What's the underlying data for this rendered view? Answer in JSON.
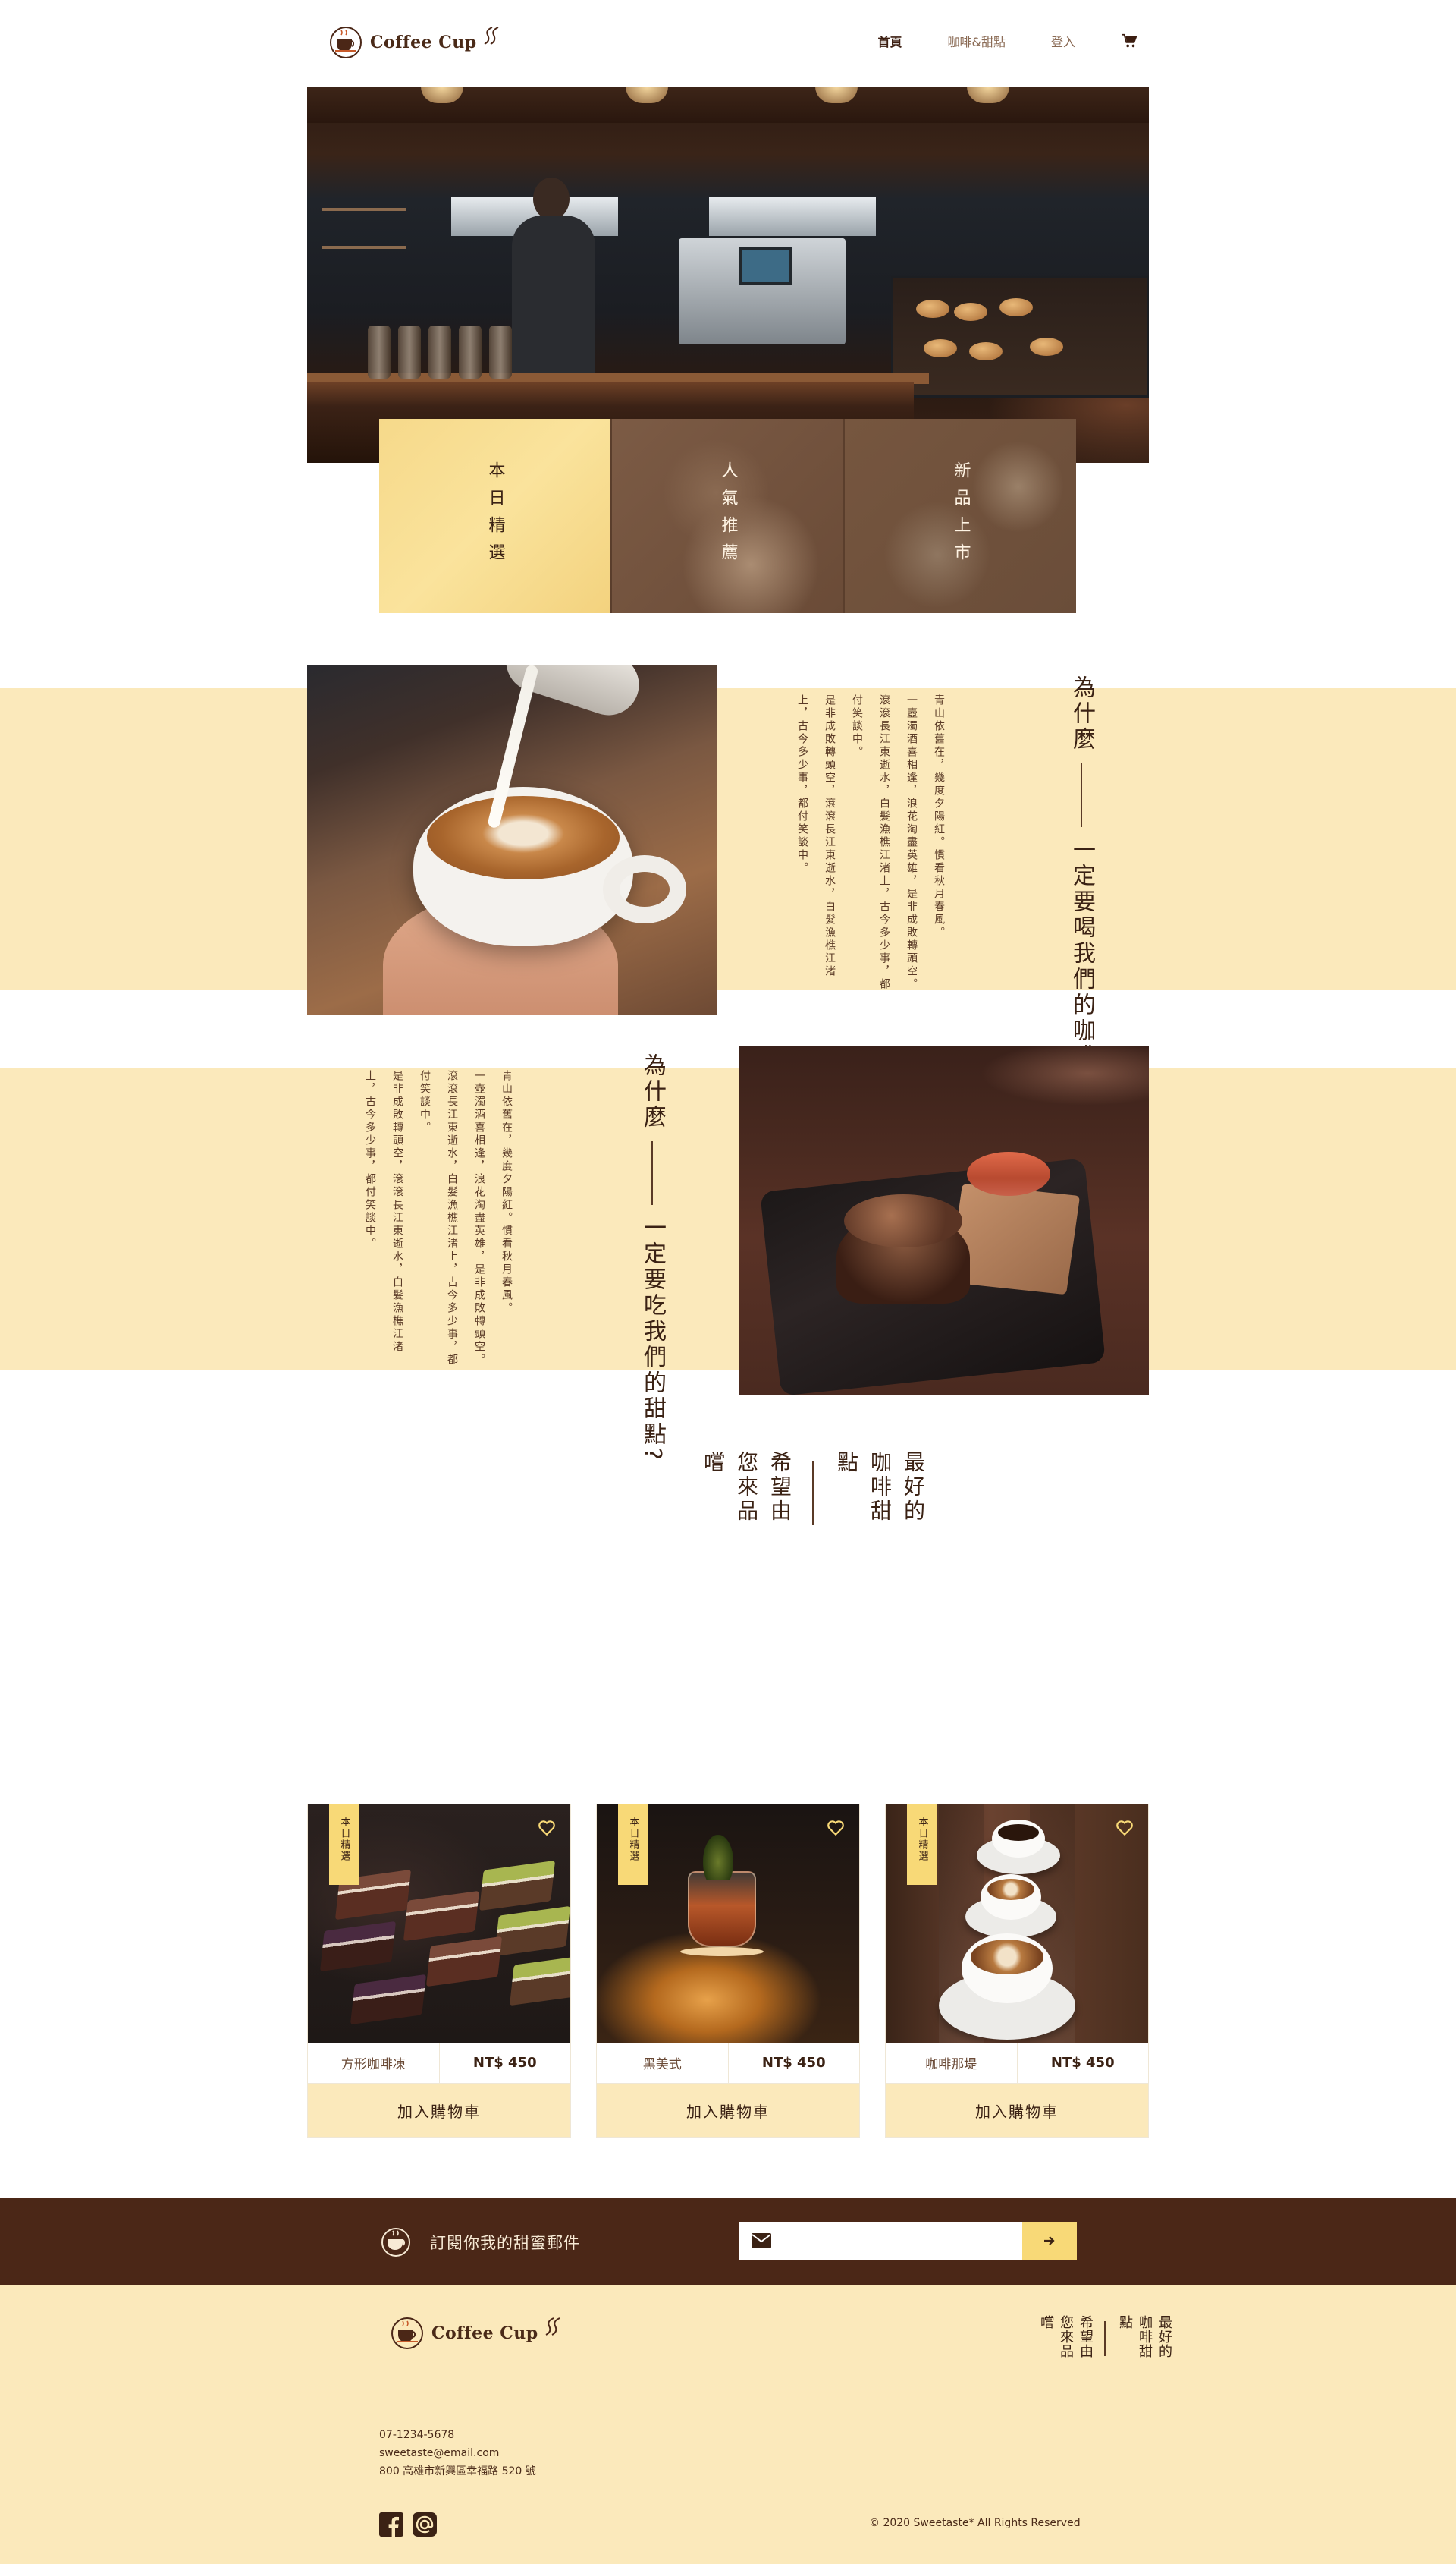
{
  "brand": {
    "name": "Coffee Cup",
    "brown": "#4b2717",
    "cream": "#fbe9bb",
    "yellow": "#f8d977"
  },
  "nav": {
    "items": [
      "首頁",
      "咖啡&甜點",
      "登入"
    ],
    "active_index": 0,
    "cart_icon": "cart-icon"
  },
  "hero": {
    "tiles": [
      "本日精選",
      "人氣推薦",
      "新品上市"
    ]
  },
  "coffee_feature": {
    "title_a": "為什麼",
    "title_b": "一定要喝我們的咖啡?",
    "paragraphs": [
      "青山依舊在，幾度夕陽紅。慣看秋月春風。",
      "一壺濁酒喜相逢，浪花淘盡英雄，是非成敗轉頭空。滾滾長江東逝水，白髮漁樵江渚上，古今多少事，都付笑談中。",
      "是非成敗轉頭空，滾滾長江東逝水，白髮漁樵江渚上，古今多少事，都付笑談中。"
    ]
  },
  "dessert_feature": {
    "title_a": "為什麼",
    "title_b": "一定要吃我們的甜點?",
    "paragraphs": [
      "青山依舊在，幾度夕陽紅。慣看秋月春風。",
      "一壺濁酒喜相逢，浪花淘盡英雄，是非成敗轉頭空。滾滾長江東逝水，白髮漁樵江渚上，古今多少事，都付笑談中。",
      "是非成敗轉頭空，滾滾長江東逝水，白髮漁樵江渚上，古今多少事，都付笑談中。"
    ]
  },
  "closing": {
    "line1": "最好的咖啡甜點",
    "line2": "希望由您來品嚐"
  },
  "products": [
    {
      "badge": "本日精選",
      "name": "方形咖啡凍",
      "price": "NT$ 450",
      "button": "加入購物車",
      "icon": "heart-icon"
    },
    {
      "badge": "本日精選",
      "name": "黑美式",
      "price": "NT$ 450",
      "button": "加入購物車",
      "icon": "heart-icon"
    },
    {
      "badge": "本日精選",
      "name": "咖啡那堤",
      "price": "NT$ 450",
      "button": "加入購物車",
      "icon": "heart-icon"
    }
  ],
  "subscribe": {
    "text": "訂閱你我的甜蜜郵件",
    "email_value": "",
    "submit_icon": "arrow-right-icon"
  },
  "footer": {
    "phone": "07-1234-5678",
    "email": "sweetaste@email.com",
    "address": "800 高雄市新興區幸福路 520 號",
    "slogan_a": "最好的咖啡甜點",
    "slogan_b": "希望由您來品嚐",
    "copyright": "© 2020 Sweetaste* All Rights Reserved",
    "social": [
      "facebook-icon",
      "at-sign-icon"
    ]
  }
}
